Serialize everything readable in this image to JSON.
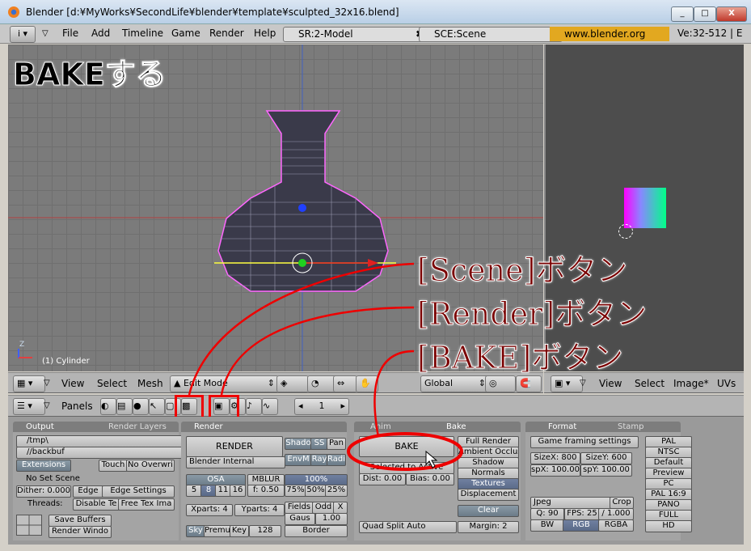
{
  "window": {
    "title": "Blender [d:¥MyWorks¥SecondLife¥blender¥template¥sculpted_32x16.blend]",
    "buttons": [
      "_",
      "□",
      "X"
    ]
  },
  "menubar": {
    "items": [
      "File",
      "Add",
      "Timeline",
      "Game",
      "Render",
      "Help"
    ],
    "screen_field": "SR:2-Model",
    "scene_field": "SCE:Scene",
    "site": "www.blender.org 248.1",
    "stats": "Ve:32-512 | E"
  },
  "viewport": {
    "heading": "BAKEする",
    "object_label": "(1) Cylinder",
    "axis_label": "Z"
  },
  "annotations": {
    "scene": "[Scene]ボタン",
    "render": "[Render]ボタン",
    "bake": "[BAKE]ボタン"
  },
  "view3d_header": {
    "items": [
      "View",
      "Select",
      "Mesh"
    ],
    "mode": "Edit Mode",
    "orientation": "Global"
  },
  "image_header": {
    "items": [
      "View",
      "Select",
      "Image*",
      "UVs"
    ]
  },
  "buttons_header": {
    "panels_label": "Panels",
    "frame": "1"
  },
  "output_panel": {
    "tab1": "Output",
    "tab2": "Render Layers",
    "path1": "/tmp\\",
    "path2": "//backbuf",
    "extensions": "Extensions",
    "touch": "Touch",
    "no_overwrite": "No Overwri",
    "no_set_scene": "No Set Scene",
    "dither": "Dither: 0.000",
    "edge": "Edge",
    "edge_settings": "Edge Settings",
    "threads": "Threads:",
    "disable_tex": "Disable Te",
    "free_tex": "Free Tex Ima",
    "save_buffers": "Save Buffers",
    "render_window": "Render Windo"
  },
  "render_panel": {
    "tab": "Render",
    "render_btn": "RENDER",
    "engine": "Blender Internal",
    "shadow": "Shado",
    "ss": "SS",
    "pan": "Pan",
    "envmap": "EnvM",
    "ray": "Ray",
    "radio": "Radi",
    "osa": "OSA",
    "osa_vals": [
      "5",
      "8",
      "11",
      "16"
    ],
    "mblur": "MBLUR",
    "blur_factor": "f: 0.50",
    "percent": "100%",
    "percent_vals": [
      "75%",
      "50%",
      "25%"
    ],
    "xparts": "Xparts: 4",
    "yparts": "Yparts: 4",
    "fields": "Fields",
    "odd": "Odd",
    "x": "X",
    "gauss": "Gaus",
    "gauss_val": "1.00",
    "sky": "Sky",
    "premul": "Premu",
    "key": "Key",
    "bits": "128",
    "border": "Border"
  },
  "bake_panel": {
    "tab1": "Anim",
    "tab2": "Bake",
    "bake_btn": "BAKE",
    "selected_to_active": "Selected to Active",
    "dist": "Dist: 0.00",
    "bias": "Bias: 0.00",
    "full_render": "Full Render",
    "ambient_occ": "Ambient Occlus",
    "shadow": "Shadow",
    "normals": "Normals",
    "textures": "Textures",
    "displacement": "Displacement",
    "clear": "Clear",
    "quad_split": "Quad Split Auto",
    "margin": "Margin: 2"
  },
  "format_panel": {
    "tab1": "Format",
    "tab2": "Stamp",
    "game_framing": "Game framing settings",
    "sizex": "SizeX: 800",
    "sizey": "SizeY: 600",
    "aspx": "spX: 100.00",
    "aspy": "spY: 100.00",
    "format": "Jpeg",
    "crop": "Crop",
    "quality": "Q: 90",
    "fps": "FPS: 25",
    "fps_base": "/ 1.000",
    "bw": "BW",
    "rgb": "RGB",
    "rgba": "RGBA",
    "presets": [
      "PAL",
      "NTSC",
      "Default",
      "Preview",
      "PC",
      "PAL 16:9",
      "PANO",
      "FULL",
      "HD"
    ]
  }
}
